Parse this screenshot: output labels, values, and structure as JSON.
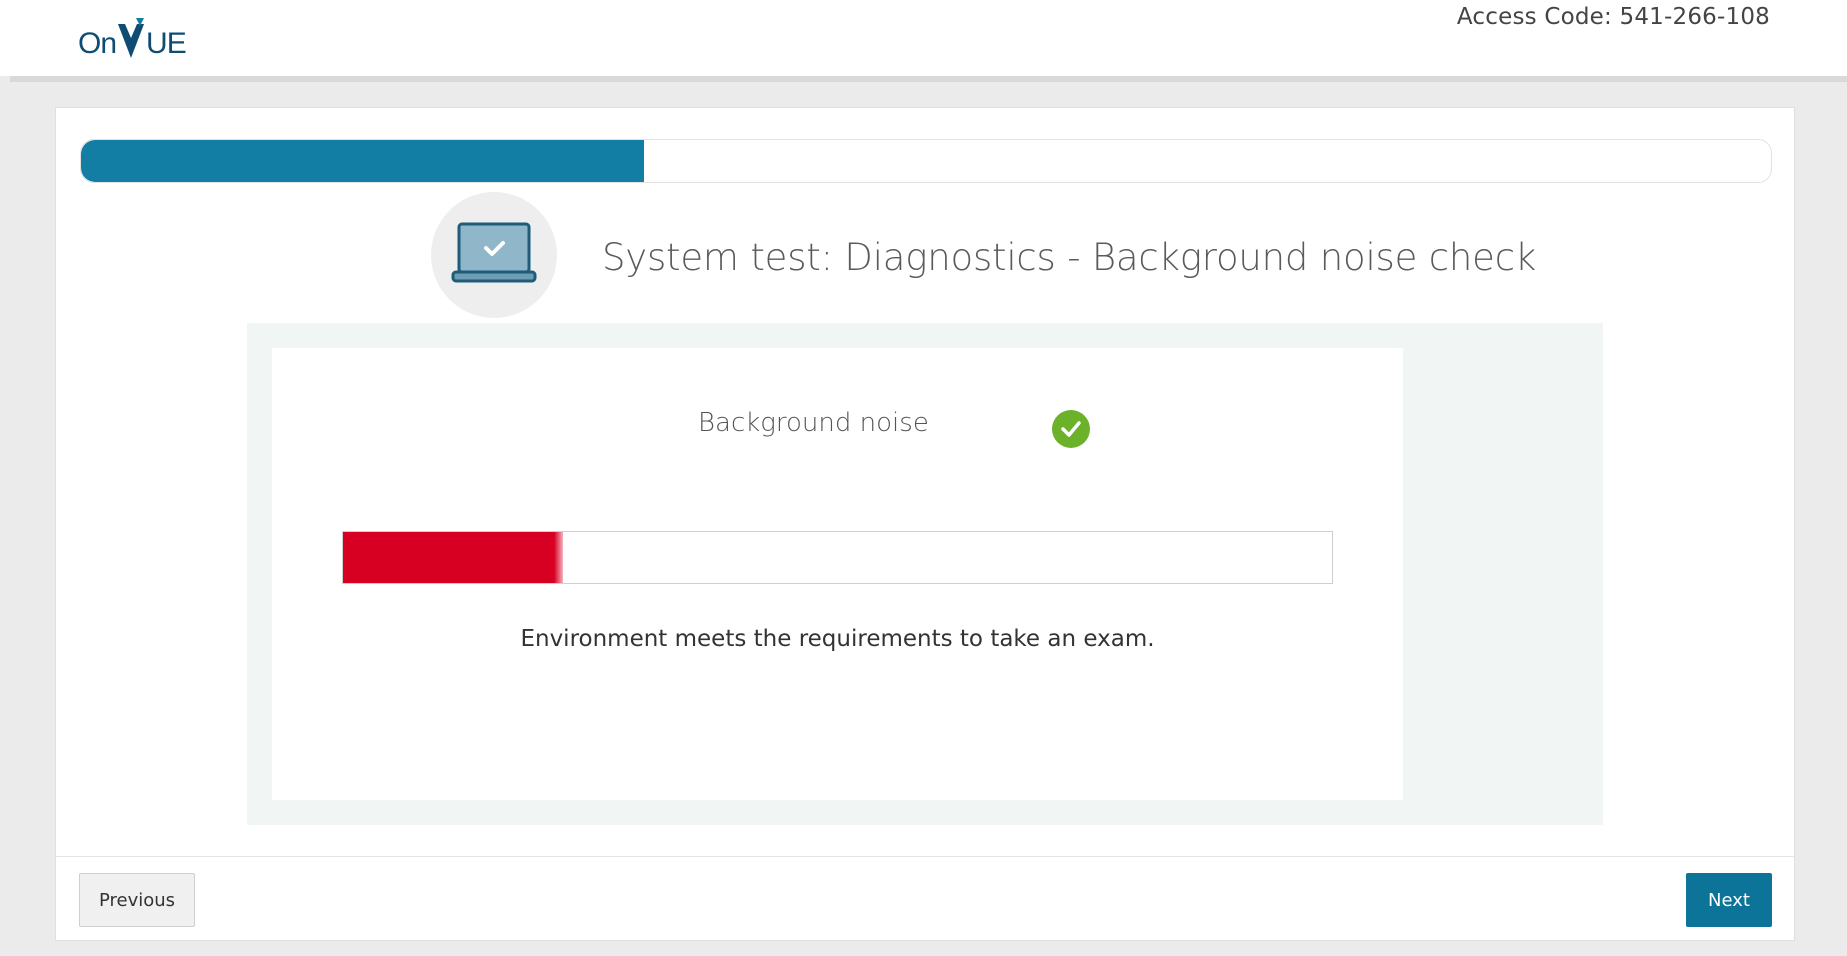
{
  "header": {
    "logo": {
      "part1": "On",
      "part2": "UE"
    },
    "access_code": "Access Code: 541-266-108"
  },
  "progress": {
    "value_fraction": 0.333
  },
  "main": {
    "title": "System test: Diagnostics - Background noise check",
    "title_icon": "laptop-check-icon",
    "test": {
      "label": "Background noise",
      "status_icon": "check-circle-icon",
      "status": "pass",
      "meter_level_fraction": 0.222,
      "meter_color": "#d80022",
      "result_text": "Environment meets the requirements to take an exam."
    }
  },
  "footer": {
    "previous_label": "Previous",
    "next_label": "Next"
  },
  "colors": {
    "brand_dark": "#0e4c73",
    "accent": "#137ea3",
    "button_primary": "#0c7499",
    "success": "#6cb12a",
    "meter_red": "#d80022"
  }
}
